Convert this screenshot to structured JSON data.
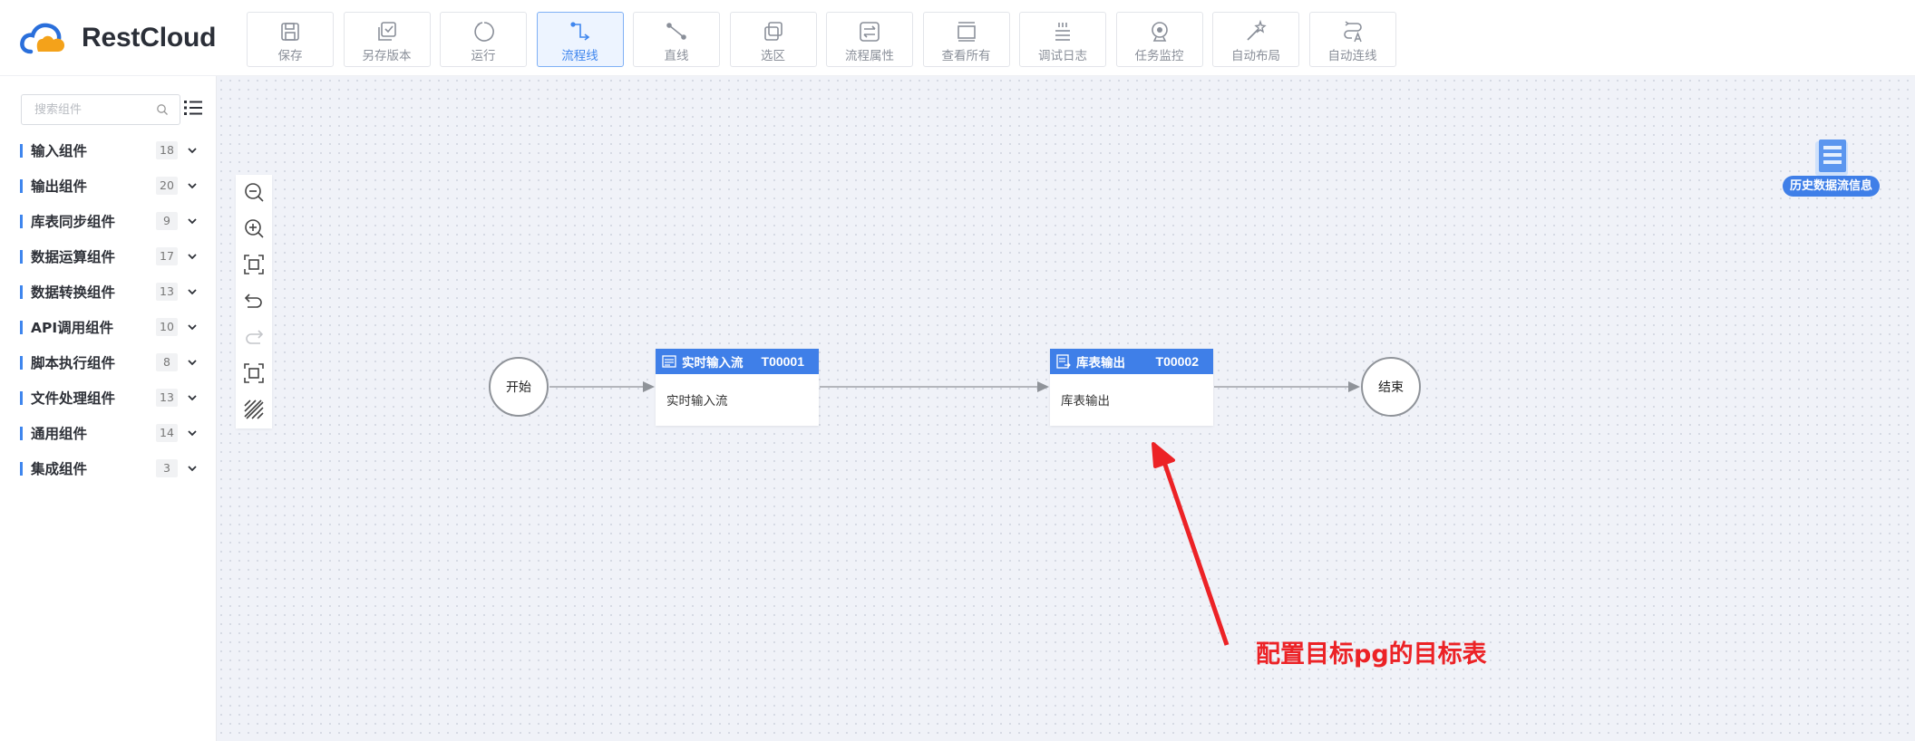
{
  "app": {
    "name": "RestCloud"
  },
  "toolbar": [
    {
      "label": "保存",
      "icon": "save-icon",
      "active": false
    },
    {
      "label": "另存版本",
      "icon": "save-version-icon",
      "active": false
    },
    {
      "label": "运行",
      "icon": "run-icon",
      "active": false
    },
    {
      "label": "流程线",
      "icon": "flow-line-icon",
      "active": true
    },
    {
      "label": "直线",
      "icon": "straight-line-icon",
      "active": false
    },
    {
      "label": "选区",
      "icon": "select-area-icon",
      "active": false
    },
    {
      "label": "流程属性",
      "icon": "flow-properties-icon",
      "active": false
    },
    {
      "label": "查看所有",
      "icon": "view-all-icon",
      "active": false
    },
    {
      "label": "调试日志",
      "icon": "debug-log-icon",
      "active": false
    },
    {
      "label": "任务监控",
      "icon": "task-monitor-icon",
      "active": false
    },
    {
      "label": "自动布局",
      "icon": "auto-layout-icon",
      "active": false
    },
    {
      "label": "自动连线",
      "icon": "auto-connect-icon",
      "active": false
    }
  ],
  "sidebar": {
    "search_placeholder": "搜索组件",
    "categories": [
      {
        "label": "输入组件",
        "count": "18"
      },
      {
        "label": "输出组件",
        "count": "20"
      },
      {
        "label": "库表同步组件",
        "count": "9"
      },
      {
        "label": "数据运算组件",
        "count": "17"
      },
      {
        "label": "数据转换组件",
        "count": "13"
      },
      {
        "label": "API调用组件",
        "count": "10"
      },
      {
        "label": "脚本执行组件",
        "count": "8"
      },
      {
        "label": "文件处理组件",
        "count": "13"
      },
      {
        "label": "通用组件",
        "count": "14"
      },
      {
        "label": "集成组件",
        "count": "3"
      }
    ]
  },
  "canvas": {
    "start_label": "开始",
    "end_label": "结束",
    "nodes": [
      {
        "title": "实时输入流",
        "code": "T00001",
        "body": "实时输入流"
      },
      {
        "title": "库表输出",
        "code": "T00002",
        "body": "库表输出"
      }
    ],
    "history_label": "历史数据流信息",
    "annotation": "配置目标pg的目标表"
  },
  "colors": {
    "accent": "#3f7fe8",
    "annotation": "#ec2226",
    "canvas_bg": "#f0f2f8"
  }
}
